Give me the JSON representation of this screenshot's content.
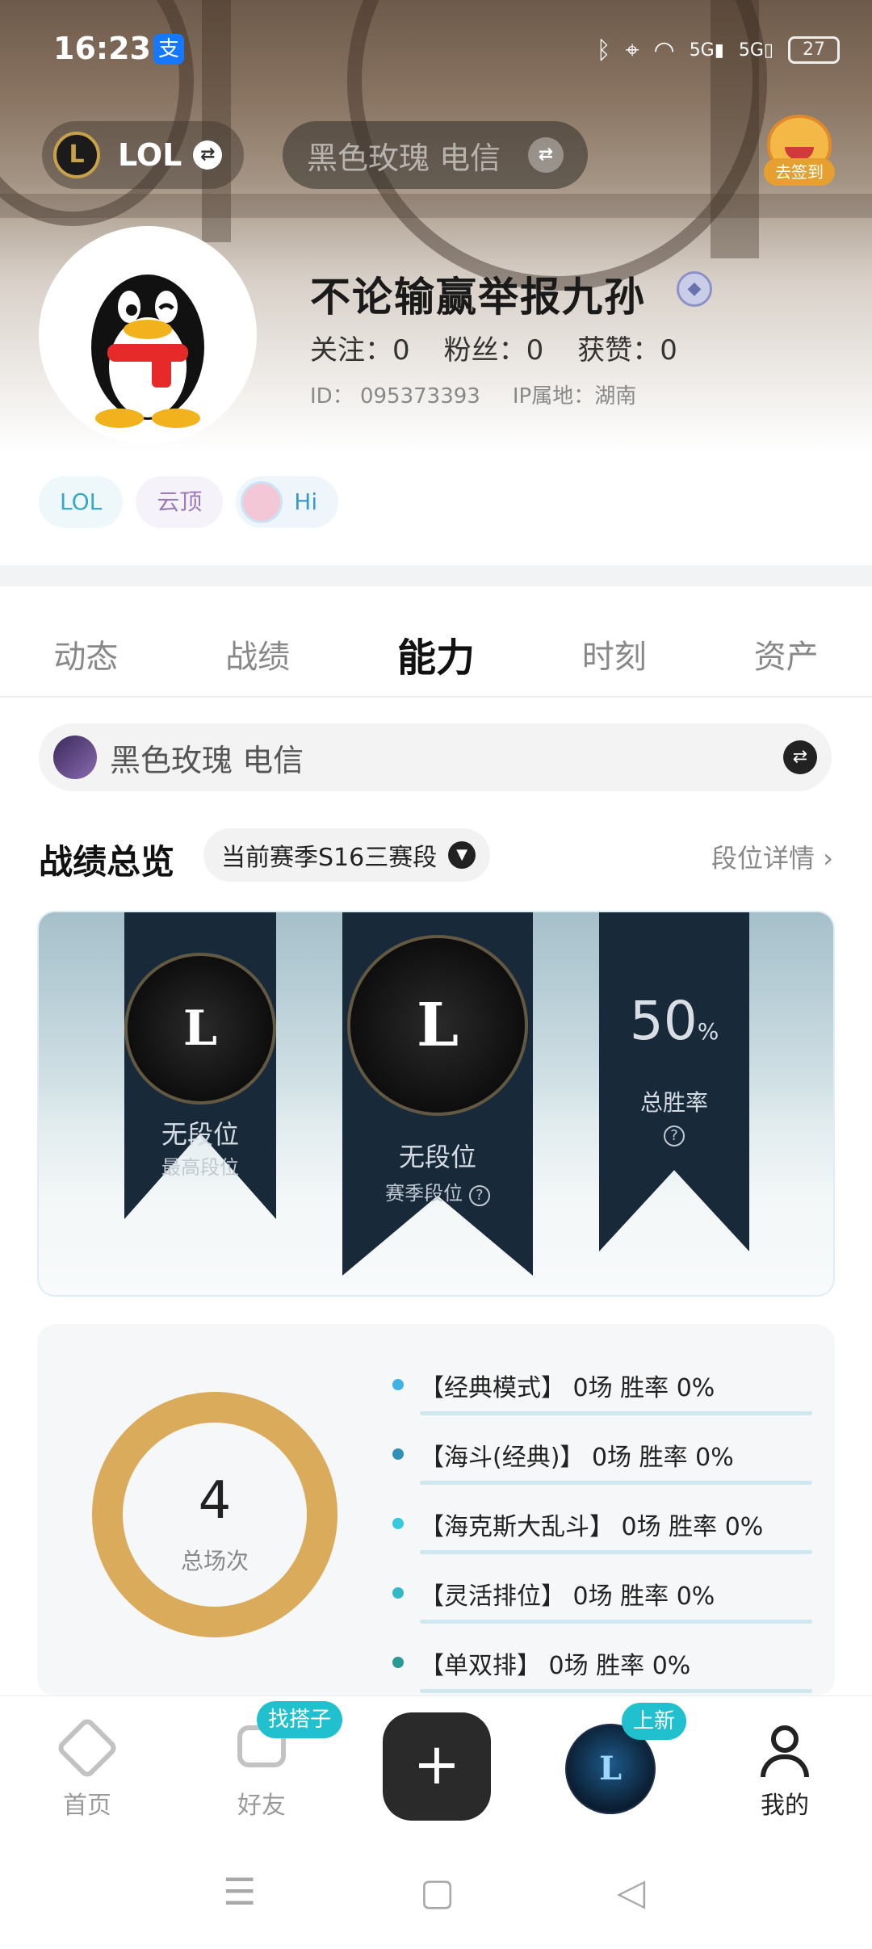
{
  "status_bar": {
    "time": "16:23",
    "alipay_glyph": "支",
    "battery": "27",
    "signal_1": "5G",
    "signal_2": "5G"
  },
  "header": {
    "game_label": "LOL",
    "lol_logo_letter": "L",
    "server_placeholder": "黑色玫瑰 电信",
    "checkin_label": "去签到",
    "swap_glyph": "⇄"
  },
  "profile": {
    "username": "不论输赢举报九孙",
    "follow_label": "关注：",
    "follow_count": "0",
    "fans_label": "粉丝：",
    "fans_count": "0",
    "likes_label": "获赞：",
    "likes_count": "0",
    "id_label": "ID：",
    "id_value": "095373393",
    "ip_label": "IP属地：",
    "ip_value": "湖南",
    "tags": [
      "LOL",
      "云顶",
      "Hi"
    ]
  },
  "tabs": [
    "动态",
    "战绩",
    "能力",
    "时刻",
    "资产"
  ],
  "account": {
    "server": "黑色玫瑰 电信"
  },
  "overview": {
    "title": "战绩总览",
    "season": "当前赛季S16三赛段",
    "rank_detail": "段位详情",
    "highest": {
      "emblem": "L",
      "rank": "无段位",
      "label": "最高段位"
    },
    "season_rank": {
      "emblem": "L",
      "rank": "无段位",
      "label": "赛季段位"
    },
    "win_rate": {
      "value": "50",
      "unit": "%",
      "label": "总胜率"
    }
  },
  "match_stats": {
    "total": "4",
    "total_label": "总场次",
    "ring_color": "#d9ab5a",
    "modes": [
      {
        "name": "【经典模式】 0场   胜率 0%",
        "color": "#3fb3e3"
      },
      {
        "name": "【海斗(经典)】 0场   胜率 0%",
        "color": "#2e8fb8"
      },
      {
        "name": "【海克斯大乱斗】 0场   胜率 0%",
        "color": "#39c9dc"
      },
      {
        "name": "【灵活排位】 0场   胜率 0%",
        "color": "#33b8c8"
      },
      {
        "name": "【单双排】 0场   胜率 0%",
        "color": "#2a9a94"
      }
    ]
  },
  "bottom_nav": {
    "home": "首页",
    "friends": "好友",
    "friends_badge": "找搭子",
    "plus": "+",
    "game_badge": "上新",
    "game_letter": "L",
    "me": "我的"
  },
  "system_nav": {
    "menu": "☰",
    "home": "▢",
    "back": "◁"
  }
}
